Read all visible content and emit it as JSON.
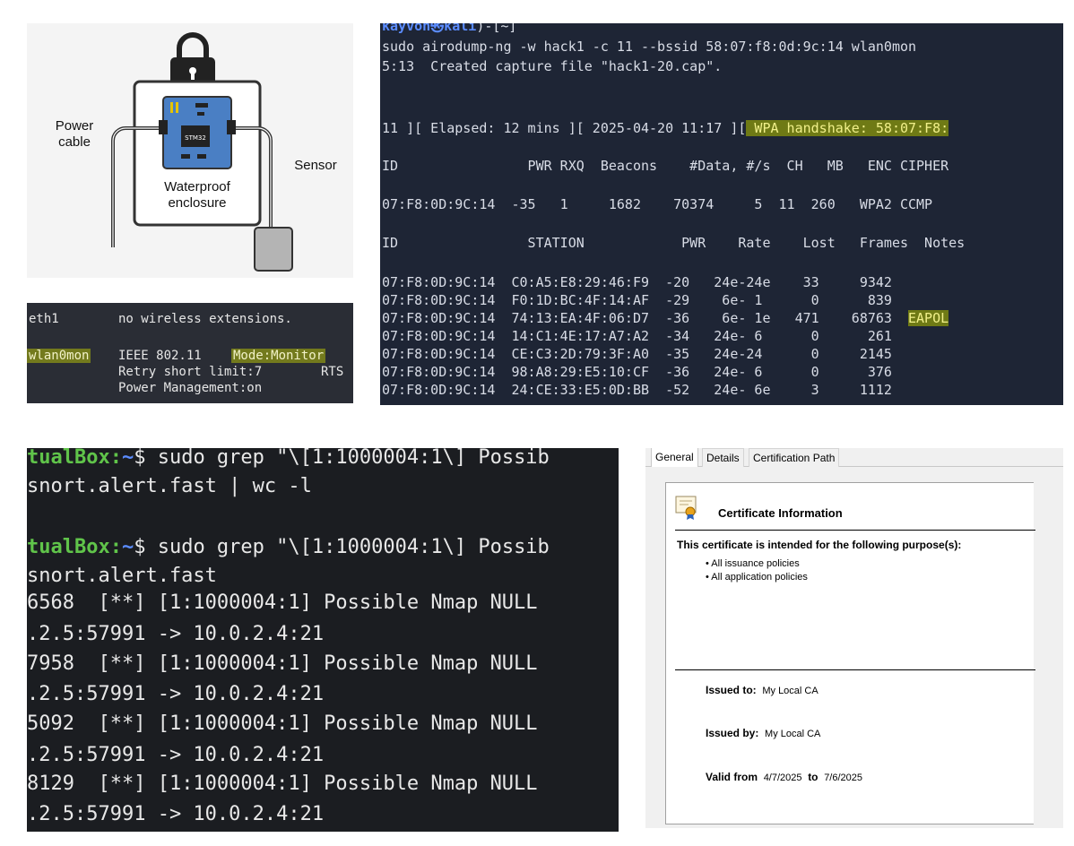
{
  "diagram": {
    "label_power_cable": "Power\ncable",
    "label_sensor": "Sensor",
    "label_enclosure": "Waterproof\nenclosure",
    "chip_label": "STM32"
  },
  "iwconfig": {
    "eth1_iface": "eth1",
    "eth1_msg": "no wireless extensions.",
    "wlan_iface": "wlan0mon",
    "wlan_standard": "IEEE 802.11",
    "wlan_mode": "Mode:Monitor",
    "retry_line": "Retry short limit:7",
    "rts": "RTS",
    "power_mgmt": "Power Management:on"
  },
  "airodump": {
    "prompt_user": "kayvon㉿kali",
    "prompt_rest": ")-[~]",
    "command": "sudo airodump-ng -w hack1 -c 11 --bssid 58:07:f8:0d:9c:14 wlan0mon",
    "created": "5:13  Created capture file \"hack1-20.cap\".",
    "status_prefix": "11 ][ Elapsed: 12 mins ][ 2025-04-20 11:17 ][",
    "handshake": " WPA handshake: 58:07:F8:",
    "ap_header": "ID                PWR RXQ  Beacons    #Data, #/s  CH   MB   ENC CIPHER",
    "ap_row": "07:F8:0D:9C:14  -35   1     1682    70374     5  11  260   WPA2 CCMP",
    "station_header": "ID                STATION            PWR    Rate    Lost   Frames  Notes",
    "stations": [
      {
        "text": "07:F8:0D:9C:14  C0:A5:E8:29:46:F9  -20   24e-24e    33     9342",
        "note": ""
      },
      {
        "text": "07:F8:0D:9C:14  F0:1D:BC:4F:14:AF  -29    6e- 1      0      839",
        "note": ""
      },
      {
        "text": "07:F8:0D:9C:14  74:13:EA:4F:06:D7  -36    6e- 1e   471    68763  ",
        "note": "EAPOL"
      },
      {
        "text": "07:F8:0D:9C:14  14:C1:4E:17:A7:A2  -34   24e- 6      0      261",
        "note": ""
      },
      {
        "text": "07:F8:0D:9C:14  CE:C3:2D:79:3F:A0  -35   24e-24      0     2145",
        "note": ""
      },
      {
        "text": "07:F8:0D:9C:14  98:A8:29:E5:10:CF  -36   24e- 6      0      376",
        "note": ""
      },
      {
        "text": "07:F8:0D:9C:14  24:CE:33:E5:0D:BB  -52   24e- 6e     3     1112",
        "note": ""
      }
    ]
  },
  "snort": {
    "host": "tualBox:",
    "path": "~",
    "cmd1": "$ sudo grep \"\\[1:1000004:1\\] Possib",
    "cmd1_cont": "snort.alert.fast | wc -l",
    "cmd2": "$ sudo grep \"\\[1:1000004:1\\] Possib",
    "cmd2_cont": "snort.alert.fast",
    "alerts": [
      {
        "id": "6568",
        "rule": "  [**] [1:1000004:1] Possible Nmap NULL",
        "conn": ".2.5:57991 -> 10.0.2.4:21"
      },
      {
        "id": "7958",
        "rule": "  [**] [1:1000004:1] Possible Nmap NULL",
        "conn": ".2.5:57991 -> 10.0.2.4:21"
      },
      {
        "id": "5092",
        "rule": "  [**] [1:1000004:1] Possible Nmap NULL",
        "conn": ".2.5:57991 -> 10.0.2.4:21"
      },
      {
        "id": "8129",
        "rule": "  [**] [1:1000004:1] Possible Nmap NULL",
        "conn": ".2.5:57991 -> 10.0.2.4:21"
      }
    ]
  },
  "certificate": {
    "tabs": [
      "General",
      "Details",
      "Certification Path"
    ],
    "title": "Certificate Information",
    "purpose_heading": "This certificate is intended for the following purpose(s):",
    "purposes": [
      "• All issuance policies",
      "• All application policies"
    ],
    "issued_to_label": "Issued to:",
    "issued_to": "My Local CA",
    "issued_by_label": "Issued by:",
    "issued_by": "My Local CA",
    "valid_from_label": "Valid from",
    "valid_from": "4/7/2025",
    "to_label": "to",
    "valid_to": "7/6/2025"
  }
}
